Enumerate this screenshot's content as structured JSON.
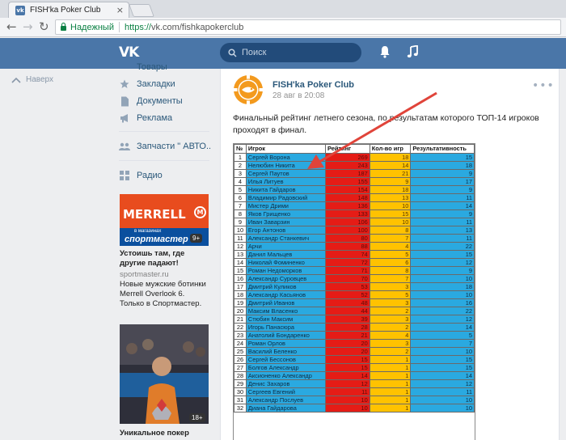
{
  "browser": {
    "tab_title": "FISH'ka Poker Club",
    "tab_icon": "vk-icon",
    "secure_label": "Надежный",
    "url_scheme": "https://",
    "url_rest": "vk.com/fishkapokerclub"
  },
  "vk_header": {
    "logo": "VK",
    "search_placeholder": "Поиск",
    "accent": "#4a76a8"
  },
  "left_nav": {
    "back_label": "Наверх",
    "items": [
      {
        "label": "Товары",
        "icon": "cart-icon"
      },
      {
        "label": "Закладки",
        "icon": "star-icon"
      },
      {
        "label": "Документы",
        "icon": "document-icon"
      },
      {
        "label": "Реклама",
        "icon": "megaphone-icon"
      },
      {
        "label": "Запчасти \" АВТО..",
        "icon": "group-icon"
      },
      {
        "label": "Радио",
        "icon": "apps-icon"
      }
    ]
  },
  "ads": [
    {
      "brand": "MERRELL",
      "brand_mark": "M",
      "band_small": "в магазинах",
      "band_store": "спортмастер",
      "age": "9+",
      "title": "Устоишь там, где другие падают!",
      "domain": "sportmaster.ru",
      "description": "Новые мужские ботинки Merrell Overlook 6. Только в Спортмастер."
    },
    {
      "age": "18+",
      "title": "Уникальное покер"
    }
  ],
  "post": {
    "author": "FISH'ka Poker Club",
    "date": "28 авг в 20:08",
    "text": "Финальный рейтинг летнего сезона, по результатам которого ТОП-14 игроков проходят в финал."
  },
  "ranking_table": {
    "headers": [
      "№",
      "Игрок",
      "Рейтинг",
      "Кол-во игр",
      "Результативность"
    ],
    "rows": [
      [
        "1",
        "Сергей Ворона",
        "269",
        "18",
        "15"
      ],
      [
        "2",
        "Нелюбин Никита",
        "243",
        "14",
        "18"
      ],
      [
        "3",
        "Сергей Паутов",
        "187",
        "21",
        "9"
      ],
      [
        "4",
        "Илья Литуев",
        "155",
        "9",
        "17"
      ],
      [
        "5",
        "Никита Гайдаров",
        "154",
        "18",
        "9"
      ],
      [
        "6",
        "Владимир Радовский",
        "148",
        "13",
        "11"
      ],
      [
        "7",
        "Мистер Дрими",
        "136",
        "10",
        "14"
      ],
      [
        "8",
        "Яков Грищенко",
        "133",
        "15",
        "9"
      ],
      [
        "9",
        "Иван Заварзин",
        "106",
        "10",
        "11"
      ],
      [
        "10",
        "Егор Антонов",
        "100",
        "8",
        "13"
      ],
      [
        "11",
        "Александр Станкевич",
        "80",
        "7",
        "11"
      ],
      [
        "12",
        "Арчи",
        "88",
        "4",
        "22"
      ],
      [
        "13",
        "Данил Мальцев",
        "74",
        "5",
        "15"
      ],
      [
        "14",
        "Николай Фоминенко",
        "72",
        "6",
        "12"
      ],
      [
        "15",
        "Роман Недоморков",
        "71",
        "8",
        "9"
      ],
      [
        "16",
        "Александр Суровцев",
        "70",
        "7",
        "10"
      ],
      [
        "17",
        "Дмитрий Куликов",
        "53",
        "3",
        "18"
      ],
      [
        "18",
        "Александр Касьянов",
        "52",
        "5",
        "10"
      ],
      [
        "19",
        "Дмитрий Иванов",
        "48",
        "3",
        "16"
      ],
      [
        "20",
        "Максим Власенко",
        "44",
        "2",
        "22"
      ],
      [
        "21",
        "Стюбин Максим",
        "39",
        "3",
        "12"
      ],
      [
        "22",
        "Игорь Панасюра",
        "28",
        "2",
        "14"
      ],
      [
        "23",
        "Анатолий Бондаренко",
        "21",
        "4",
        "5"
      ],
      [
        "24",
        "Роман Орлов",
        "20",
        "3",
        "7"
      ],
      [
        "25",
        "Василий Беленко",
        "20",
        "2",
        "10"
      ],
      [
        "26",
        "Сергей Бессонов",
        "15",
        "1",
        "15"
      ],
      [
        "27",
        "Болгов Александр",
        "15",
        "1",
        "15"
      ],
      [
        "28",
        "Аксионенко Александр",
        "14",
        "1",
        "14"
      ],
      [
        "29",
        "Денис Захаров",
        "12",
        "1",
        "12"
      ],
      [
        "30",
        "Сергеев Евгений",
        "11",
        "1",
        "11"
      ],
      [
        "31",
        "Александр Послуев",
        "10",
        "1",
        "10"
      ],
      [
        "32",
        "Диана Гайдарова",
        "10",
        "1",
        "10"
      ]
    ],
    "colors": {
      "name": "#2aa9e0",
      "rating": "#e51c16",
      "games": "#ffc200",
      "efficiency": "#2aa9e0"
    }
  }
}
